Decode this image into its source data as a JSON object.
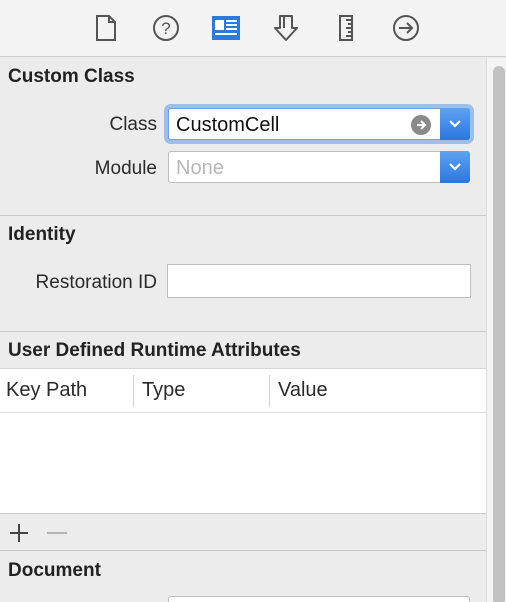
{
  "toolbar": {
    "tabs": [
      {
        "name": "file-inspector-icon"
      },
      {
        "name": "quick-help-icon"
      },
      {
        "name": "identity-inspector-icon",
        "active": true
      },
      {
        "name": "attributes-inspector-icon"
      },
      {
        "name": "size-inspector-icon"
      },
      {
        "name": "connections-inspector-icon"
      }
    ]
  },
  "custom_class": {
    "title": "Custom Class",
    "class_label": "Class",
    "class_value": "CustomCell",
    "module_label": "Module",
    "module_placeholder": "None"
  },
  "identity": {
    "title": "Identity",
    "restoration_label": "Restoration ID",
    "restoration_value": ""
  },
  "runtime_attributes": {
    "title": "User Defined Runtime Attributes",
    "columns": [
      "Key Path",
      "Type",
      "Value"
    ],
    "rows": []
  },
  "document": {
    "title": "Document"
  },
  "colors": {
    "accent": "#2a77e0",
    "focus_ring": "#5a9be6",
    "active_tab": "#2b7bdc"
  }
}
